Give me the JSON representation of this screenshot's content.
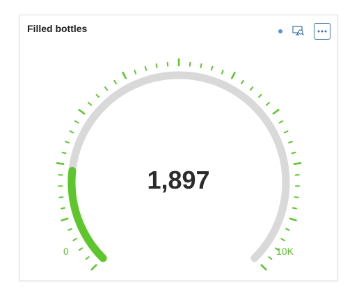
{
  "card": {
    "title": "Filled bottles",
    "status_dot_color": "#5b8fe0",
    "icons": {
      "insights": "monitor-search-icon",
      "more": "more-options-icon"
    }
  },
  "gauge": {
    "value": 1897,
    "value_label": "1,897",
    "min": 0,
    "max": 10000,
    "min_label": "0",
    "max_label": "10K",
    "colors": {
      "fill": "#5cc62b",
      "track": "#d9d9d9",
      "ticks": "#5cc62b",
      "value_text": "#2b2b2b"
    }
  }
}
